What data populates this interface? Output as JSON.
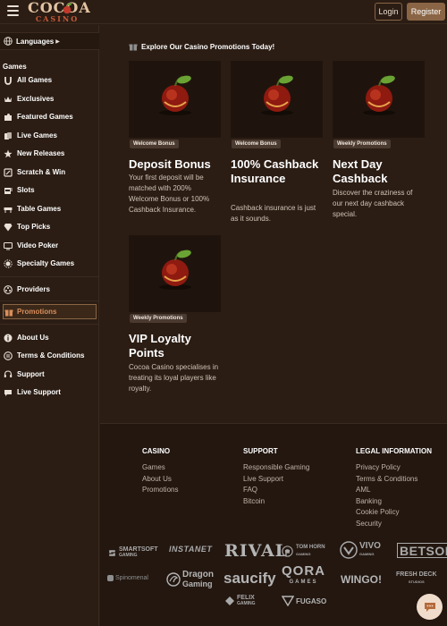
{
  "header": {
    "logo_main": "COCOA",
    "logo_sub": "CASINO",
    "login_label": "Login",
    "register_label": "Register"
  },
  "sidebar": {
    "languages_label": "Languages",
    "games_heading": "Games",
    "games": [
      {
        "label": "All Games",
        "icon": "horseshoe-icon"
      },
      {
        "label": "Exclusives",
        "icon": "crown-icon"
      },
      {
        "label": "Featured Games",
        "icon": "puzzle-icon"
      },
      {
        "label": "Live Games",
        "icon": "cards-icon"
      },
      {
        "label": "New Releases",
        "icon": "star-icon"
      },
      {
        "label": "Scratch & Win",
        "icon": "scratch-card-icon"
      },
      {
        "label": "Slots",
        "icon": "slot-machine-icon"
      },
      {
        "label": "Table Games",
        "icon": "table-icon"
      },
      {
        "label": "Top Picks",
        "icon": "diamond-icon"
      },
      {
        "label": "Video Poker",
        "icon": "video-poker-icon"
      },
      {
        "label": "Specialty Games",
        "icon": "specialty-icon"
      }
    ],
    "providers_label": "Providers",
    "promotions_label": "Promotions",
    "about": [
      {
        "label": "About Us",
        "icon": "info-icon"
      },
      {
        "label": "Terms & Conditions",
        "icon": "document-icon"
      },
      {
        "label": "Support",
        "icon": "support-icon"
      },
      {
        "label": "Live Support",
        "icon": "chat-icon"
      }
    ]
  },
  "main": {
    "intro": "Explore Our Casino Promotions Today!",
    "cards": [
      {
        "badge": "Welcome Bonus",
        "title": "Deposit Bonus",
        "desc": "Your first deposit will be matched with 200% Welcome Bonus or 100% Cashback Insurance."
      },
      {
        "badge": "Welcome Bonus",
        "title": "100% Cashback Insurance",
        "desc": "Cashback insurance is just as it sounds."
      },
      {
        "badge": "Weekly Promotions",
        "title": "Next Day Cashback",
        "desc": "Discover the craziness of our next day cashback special."
      },
      {
        "badge": "Weekly Promotions",
        "title": "VIP Loyalty Points",
        "desc": "Cocoa Casino specialises in treating its loyal players like royalty."
      }
    ]
  },
  "footer": {
    "casino": {
      "heading": "CASINO",
      "links": [
        "Games",
        "About Us",
        "Promotions"
      ]
    },
    "support": {
      "heading": "SUPPORT",
      "links": [
        "Responsible Gaming",
        "Live Support",
        "FAQ",
        "Bitcoin"
      ]
    },
    "legal": {
      "heading": "LEGAL INFORMATION",
      "links": [
        "Privacy Policy",
        "Terms & Conditions",
        "AML",
        "Banking",
        "Cookie Policy",
        "Security"
      ]
    },
    "providers": {
      "smartsoft": "SMARTSOFT",
      "smartsoft_sub": "GAMING",
      "instanet": "INSTANET",
      "rival": "RIVAL",
      "tomhorn": "TOM HORN",
      "tomhorn_sub": "GAMING",
      "vivo": "VIVO",
      "vivo_sub": "GAMING",
      "betsoft": "BETSOFT",
      "spinomenal": "Spinomenal",
      "dragon": "Dragon",
      "dragon_sub": "Gaming",
      "saucify": "saucify",
      "qora": "QORA",
      "qora_sub": "GAMES",
      "wingo": "WINGO!",
      "freshdeck": "FRESH DECK",
      "freshdeck_sub": "STUDIOS",
      "felix": "FELIX",
      "felix_sub": "GAMING",
      "fugaso": "FUGASO"
    }
  },
  "colors": {
    "background": "#2b1d14",
    "accent": "#8a6545",
    "promo_highlight": "#d98e5c",
    "badge": "#4a3a30"
  }
}
